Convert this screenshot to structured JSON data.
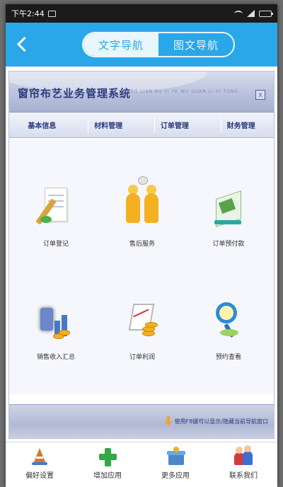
{
  "status_bar": {
    "time": "下午2:44"
  },
  "nav": {
    "back_icon": "chevron-left-icon",
    "tabs": [
      {
        "label": "文字导航",
        "active": true
      },
      {
        "label": "图文导航",
        "active": false
      }
    ]
  },
  "app": {
    "title": "窗帘布艺业务管理系统",
    "subtitle": "CHUANG LIAN BU YI YE WU GUAN LI XI TONG",
    "close_label": "X",
    "menu": [
      "基本信息",
      "材料管理",
      "订单管理",
      "财务管理"
    ],
    "tiles": [
      {
        "label": "订单登记",
        "icon": "document-pen-icon"
      },
      {
        "label": "售后服务",
        "icon": "people-service-icon"
      },
      {
        "label": "订单预付款",
        "icon": "payment-book-icon"
      },
      {
        "label": "销售收入汇总",
        "icon": "sales-chart-icon"
      },
      {
        "label": "订单利润",
        "icon": "profit-chart-icon"
      },
      {
        "label": "预约查看",
        "icon": "magnifier-globe-icon"
      }
    ],
    "footer_hint": "使用F8键可以显示/隐藏当前导航窗口"
  },
  "tabbar": [
    {
      "label": "偏好设置",
      "icon": "preferences-icon"
    },
    {
      "label": "增加应用",
      "icon": "add-app-icon"
    },
    {
      "label": "更多应用",
      "icon": "more-apps-icon"
    },
    {
      "label": "联系我们",
      "icon": "contact-us-icon"
    }
  ],
  "colors": {
    "accent": "#2aa7e8",
    "title_text": "#2a3a7c",
    "status_bar": "#1b1b1b"
  }
}
